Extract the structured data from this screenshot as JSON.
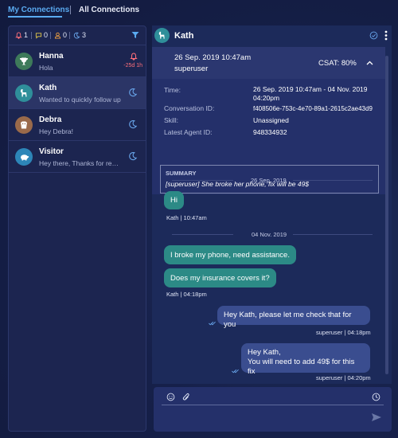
{
  "tabs": [
    {
      "label": "My Connections",
      "active": true
    },
    {
      "label": "All Connections",
      "active": false
    }
  ],
  "filters": {
    "alerts": "1",
    "messages": "0",
    "assigned": "0",
    "idle": "3"
  },
  "conversations": [
    {
      "name": "Hanna",
      "preview": "Hola",
      "time": "-25d 1h",
      "status_icon": "bell-icon",
      "avatar_icon": "trophy-icon",
      "avatar_color": "#3e7a5a"
    },
    {
      "name": "Kath",
      "preview": "Wanted to quickly follow up",
      "status_icon": "moon-icon",
      "avatar_icon": "llama-icon",
      "avatar_color": "#2f8f9a",
      "selected": true
    },
    {
      "name": "Debra",
      "preview": "Hey Debra!",
      "status_icon": "moon-icon",
      "avatar_icon": "dog-icon",
      "avatar_color": "#9a6a4a"
    },
    {
      "name": "Visitor",
      "preview": "Hey there, Thanks for reaching out",
      "status_icon": "moon-icon",
      "avatar_icon": "piggy-icon",
      "avatar_color": "#2d86b8"
    }
  ],
  "chat": {
    "title": "Kath",
    "session": {
      "date": "26 Sep. 2019 10:47am",
      "user": "superuser",
      "csat": "CSAT: 80%"
    },
    "details": [
      {
        "label": "Time:",
        "value": "26 Sep. 2019 10:47am - 04 Nov. 2019 04:20pm"
      },
      {
        "label": "Conversation ID:",
        "value": "f408506e-753c-4e70-89a1-2615c2ae43d9"
      },
      {
        "label": "Skill:",
        "value": "Unassigned"
      },
      {
        "label": "Latest Agent ID:",
        "value": "948334932"
      }
    ],
    "summary": {
      "title": "SUMMARY",
      "text": "[superuser] She broke her phone, fix will be 49$"
    },
    "day1": "26 Sep. 2019",
    "day2": "04 Nov. 2019",
    "messages": [
      {
        "text": "Hi",
        "meta": "Kath  |  10:47am"
      },
      {
        "text": "I broke my phone, need assistance."
      },
      {
        "text": "Does my insurance covers it?",
        "meta": "Kath  |  04:18pm"
      },
      {
        "text": "Hey Kath, please let me check that for you",
        "meta": "superuser  |  04:18pm"
      },
      {
        "text_line1": "Hey Kath,",
        "text_line2": "You will need to add 49$ for this fix",
        "meta": "superuser  |  04:20pm"
      }
    ]
  },
  "colors": {
    "accent": "#5aaaf0",
    "customer_bubble": "#2c8a86",
    "agent_bubble": "#3a4d8f",
    "alert": "#ff6f7a"
  }
}
